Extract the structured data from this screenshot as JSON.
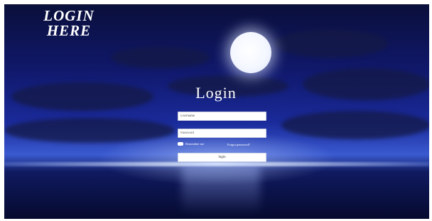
{
  "brand": {
    "line1": "LOGIN",
    "line2": "HERE"
  },
  "form": {
    "title": "Login",
    "username_placeholder": "Username",
    "password_placeholder": "Password",
    "remember_label": "Remember me",
    "forgot_label": "Forgot password?",
    "submit_label": "login"
  },
  "colors": {
    "text": "#ffffff",
    "field_bg": "#ffffff",
    "sky_dark": "#0a0f3a",
    "sky_mid": "#1a2a9a"
  }
}
